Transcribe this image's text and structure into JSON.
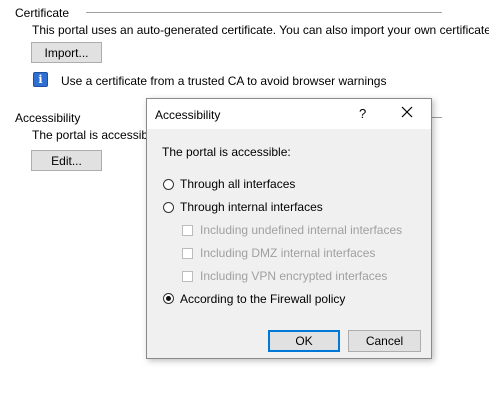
{
  "certificate": {
    "title": "Certificate",
    "description": "This portal uses an auto-generated certificate. You can also import your own certificate.",
    "import_button": "Import...",
    "info_icon": "i",
    "info_text": "Use a certificate from a trusted CA to avoid browser warnings"
  },
  "accessibility": {
    "title": "Accessibility",
    "description": "The portal is accessible",
    "edit_button": "Edit..."
  },
  "dialog": {
    "title": "Accessibility",
    "help_label": "?",
    "prompt": "The portal is accessible:",
    "options": [
      "Through all interfaces",
      "Through internal interfaces",
      "According to the Firewall policy"
    ],
    "selected_option": "According to the Firewall policy",
    "sub_options": [
      "Including undefined internal interfaces",
      "Including DMZ internal interfaces",
      "Including VPN encrypted interfaces"
    ],
    "ok_label": "OK",
    "cancel_label": "Cancel"
  },
  "colors": {
    "info_icon": "#2f6fd1",
    "default_button_border": "#0078d7",
    "dialog_background": "#f0f0f0"
  }
}
